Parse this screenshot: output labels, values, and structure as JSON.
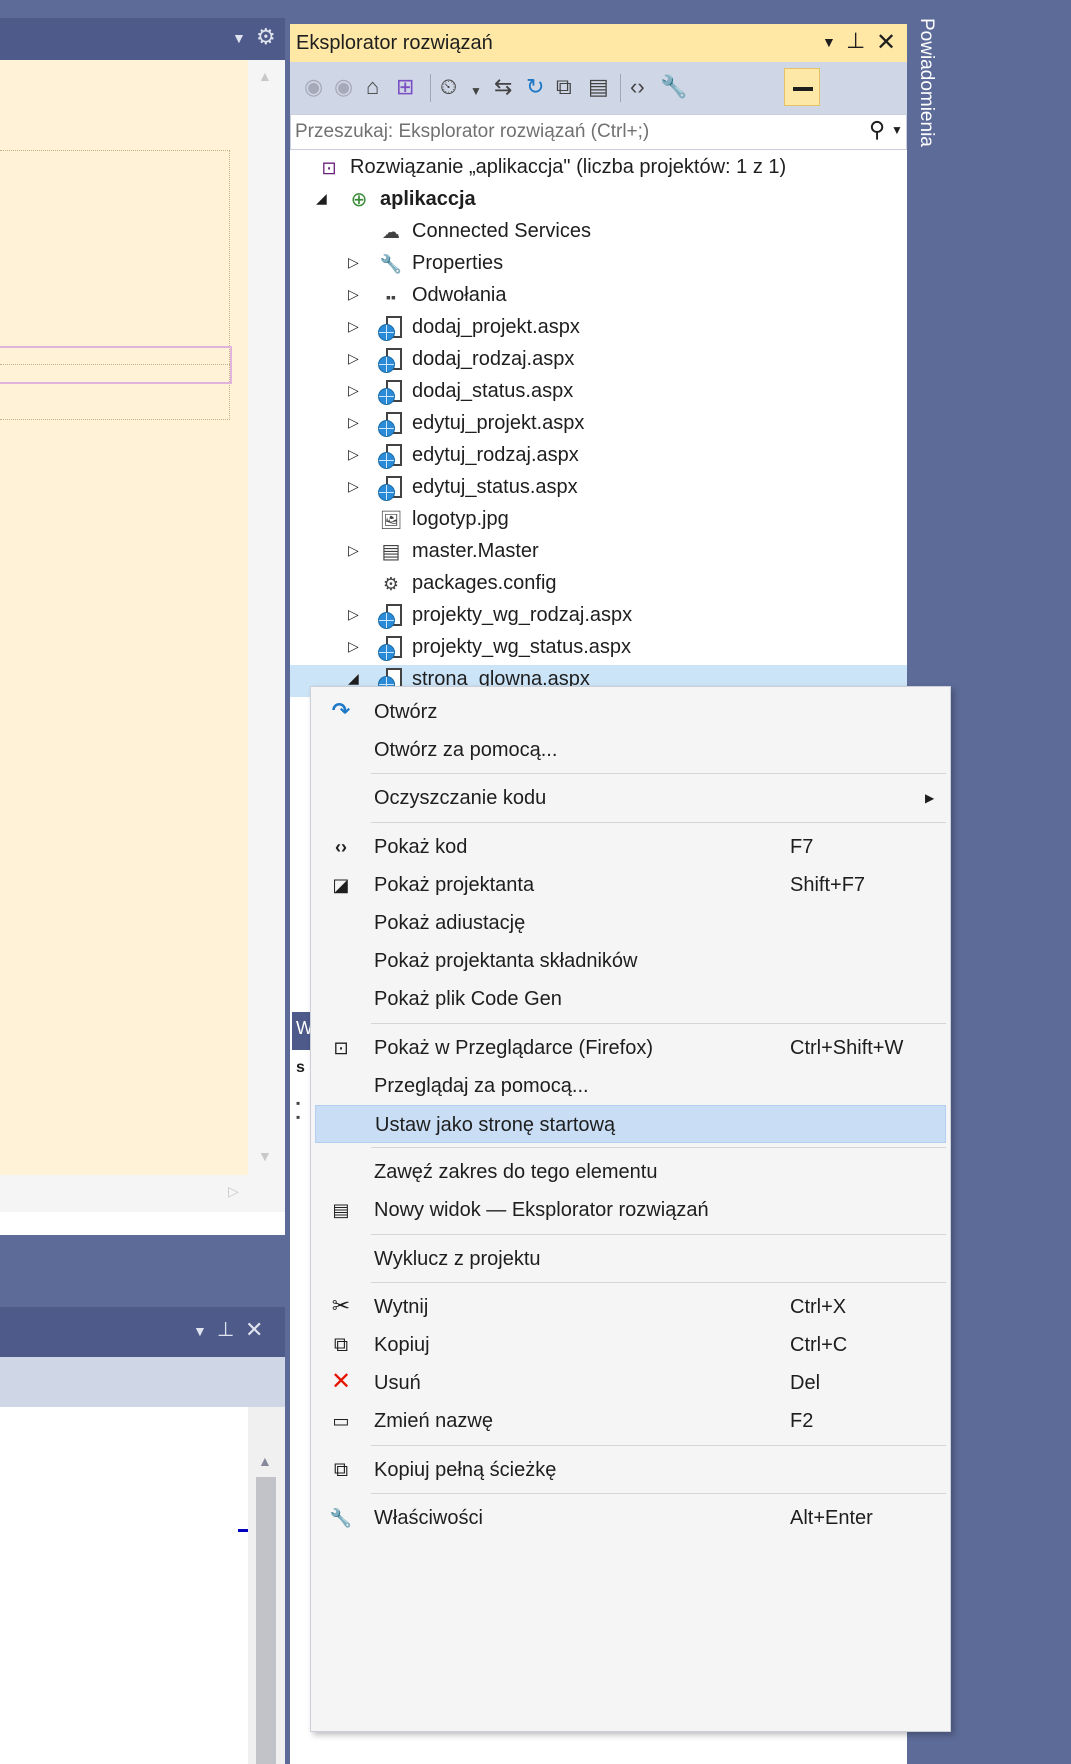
{
  "solution_explorer": {
    "title": "Eksplorator rozwiązań",
    "search_placeholder": "Przeszukaj: Eksplorator rozwiązań (Ctrl+;)",
    "tree": [
      {
        "label": "Rozwiązanie „aplikaccja\" (liczba projektów: 1 z 1)",
        "icon": "solution-icon",
        "indent": 0,
        "expander": "",
        "bold": false
      },
      {
        "label": "aplikaccja",
        "icon": "web-project-icon",
        "indent": 1,
        "expander": "◢",
        "bold": true
      },
      {
        "label": "Connected Services",
        "icon": "connected-services-icon",
        "indent": 2,
        "expander": "",
        "bold": false
      },
      {
        "label": "Properties",
        "icon": "wrench-icon",
        "indent": 2,
        "expander": "▷",
        "bold": false
      },
      {
        "label": "Odwołania",
        "icon": "references-icon",
        "indent": 2,
        "expander": "▷",
        "bold": false
      },
      {
        "label": "dodaj_projekt.aspx",
        "icon": "aspx-file-icon",
        "indent": 2,
        "expander": "▷",
        "bold": false
      },
      {
        "label": "dodaj_rodzaj.aspx",
        "icon": "aspx-file-icon",
        "indent": 2,
        "expander": "▷",
        "bold": false
      },
      {
        "label": "dodaj_status.aspx",
        "icon": "aspx-file-icon",
        "indent": 2,
        "expander": "▷",
        "bold": false
      },
      {
        "label": "edytuj_projekt.aspx",
        "icon": "aspx-file-icon",
        "indent": 2,
        "expander": "▷",
        "bold": false
      },
      {
        "label": "edytuj_rodzaj.aspx",
        "icon": "aspx-file-icon",
        "indent": 2,
        "expander": "▷",
        "bold": false
      },
      {
        "label": "edytuj_status.aspx",
        "icon": "aspx-file-icon",
        "indent": 2,
        "expander": "▷",
        "bold": false
      },
      {
        "label": "logotyp.jpg",
        "icon": "image-file-icon",
        "indent": 2,
        "expander": "",
        "bold": false
      },
      {
        "label": "master.Master",
        "icon": "master-page-icon",
        "indent": 2,
        "expander": "▷",
        "bold": false
      },
      {
        "label": "packages.config",
        "icon": "config-file-icon",
        "indent": 2,
        "expander": "",
        "bold": false
      },
      {
        "label": "projekty_wg_rodzaj.aspx",
        "icon": "aspx-file-icon",
        "indent": 2,
        "expander": "▷",
        "bold": false
      },
      {
        "label": "projekty_wg_status.aspx",
        "icon": "aspx-file-icon",
        "indent": 2,
        "expander": "▷",
        "bold": false
      },
      {
        "label": "strona_glowna.aspx",
        "icon": "aspx-file-icon",
        "indent": 2,
        "expander": "◢",
        "bold": false,
        "selected": true
      }
    ]
  },
  "notifications_tab": {
    "label": "Powiadomienia"
  },
  "behind_panel": {
    "title_initial": "W",
    "text_initial": "s"
  },
  "context_menu": {
    "items": [
      {
        "label": "Otwórz",
        "shortcut": "",
        "icon": "open-arrow-icon"
      },
      {
        "label": "Otwórz za pomocą...",
        "shortcut": "",
        "icon": ""
      },
      {
        "separator": true
      },
      {
        "label": "Oczyszczanie kodu",
        "shortcut": "",
        "icon": "",
        "submenu": true
      },
      {
        "separator": true
      },
      {
        "label": "Pokaż kod",
        "shortcut": "F7",
        "icon": "code-brackets-icon"
      },
      {
        "label": "Pokaż projektanta",
        "shortcut": "Shift+F7",
        "icon": "designer-icon"
      },
      {
        "label": "Pokaż adiustację",
        "shortcut": "",
        "icon": ""
      },
      {
        "label": "Pokaż projektanta składników",
        "shortcut": "",
        "icon": ""
      },
      {
        "label": "Pokaż plik Code Gen",
        "shortcut": "",
        "icon": ""
      },
      {
        "separator": true
      },
      {
        "label": "Pokaż w Przeglądarce (Firefox)",
        "shortcut": "Ctrl+Shift+W",
        "icon": "browser-icon"
      },
      {
        "label": "Przeglądaj za pomocą...",
        "shortcut": "",
        "icon": ""
      },
      {
        "label": "Ustaw jako stronę startową",
        "shortcut": "",
        "icon": "",
        "highlighted": true
      },
      {
        "separator": true
      },
      {
        "label": "Zawęź zakres do tego elementu",
        "shortcut": "",
        "icon": ""
      },
      {
        "label": "Nowy widok — Eksplorator rozwiązań",
        "shortcut": "",
        "icon": "new-view-icon"
      },
      {
        "separator": true
      },
      {
        "label": "Wyklucz z projektu",
        "shortcut": "",
        "icon": ""
      },
      {
        "separator": true
      },
      {
        "label": "Wytnij",
        "shortcut": "Ctrl+X",
        "icon": "scissors-icon"
      },
      {
        "label": "Kopiuj",
        "shortcut": "Ctrl+C",
        "icon": "copy-icon"
      },
      {
        "label": "Usuń",
        "shortcut": "Del",
        "icon": "delete-x-icon"
      },
      {
        "label": "Zmień nazwę",
        "shortcut": "F2",
        "icon": "rename-icon"
      },
      {
        "separator": true
      },
      {
        "label": "Kopiuj pełną ścieżkę",
        "shortcut": "",
        "icon": "copy-path-icon"
      },
      {
        "separator": true
      },
      {
        "label": "Właściwości",
        "shortcut": "Alt+Enter",
        "icon": "wrench-icon"
      }
    ]
  },
  "colors": {
    "ide_frame": "#5d6b99",
    "active_title": "#ffe8a6",
    "designer_bg": "#fff2d6",
    "selection": "#cce4f7",
    "menu_highlight": "#c9def5",
    "delete_red": "#e51400"
  }
}
